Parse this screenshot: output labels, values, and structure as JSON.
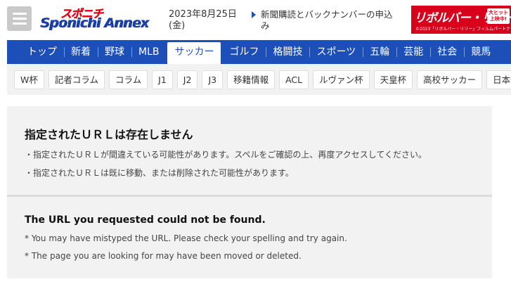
{
  "header": {
    "logo_top": "スポニチ",
    "logo_main": "Sponichi Annex",
    "date": "2023年8月25日",
    "weekday": "(金)",
    "subscribe_link": "新聞購読とバックナンバーの申込み",
    "banner": {
      "title": "リボルバー・リリー",
      "badge": "大ヒット上映中!",
      "fineprint": "©2023「リボルバー・リリー」フィルムパートナーズ"
    }
  },
  "main_nav": {
    "items": [
      "トップ",
      "新着",
      "野球",
      "MLB",
      "サッカー",
      "ゴルフ",
      "格闘技",
      "スポーツ",
      "五輪",
      "芸能",
      "社会",
      "競馬"
    ],
    "active_index": 4
  },
  "sub_nav": {
    "items": [
      "W杯",
      "記者コラム",
      "コラム",
      "J1",
      "J2",
      "J3",
      "移籍情報",
      "ACL",
      "ルヴァン杯",
      "天皇杯",
      "高校サッカー",
      "日本代表"
    ]
  },
  "error_ja": {
    "title": "指定されたＵＲＬは存在しません",
    "line1": "・指定されたＵＲＬが間違えている可能性があります。スペルをご確認の上、再度アクセスしてください。",
    "line2": "・指定されたＵＲＬは既に移動、または削除された可能性があります。"
  },
  "error_en": {
    "title": "The URL you requested could not be found.",
    "line1": "* You may have mistyped the URL. Please check your spelling and try again.",
    "line2": "* The page you are looking for may have been moved or deleted."
  },
  "colors": {
    "nav_blue": "#1d4fb8",
    "brand_red": "#e60012",
    "panel_bg": "#f2f2f2"
  }
}
